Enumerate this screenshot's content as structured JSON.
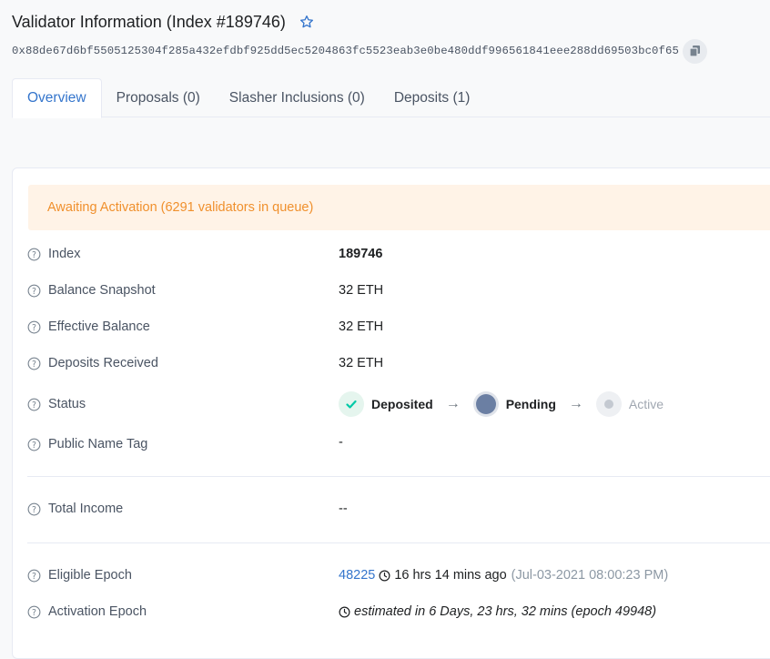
{
  "header": {
    "title": "Validator Information (Index #189746)",
    "pubkey": "0x88de67d6bf5505125304f285a432efdbf925dd5ec5204863fc5523eab3e0be480ddf996561841eee288dd69503bc0f65"
  },
  "tabs": [
    {
      "label": "Overview"
    },
    {
      "label": "Proposals (0)"
    },
    {
      "label": "Slasher Inclusions (0)"
    },
    {
      "label": "Deposits (1)"
    }
  ],
  "alert": "Awaiting Activation (6291 validators in queue)",
  "fields": {
    "index": {
      "label": "Index",
      "value": "189746"
    },
    "balance_snapshot": {
      "label": "Balance Snapshot",
      "value": "32 ETH"
    },
    "effective_balance": {
      "label": "Effective Balance",
      "value": "32 ETH"
    },
    "deposits_received": {
      "label": "Deposits Received",
      "value": "32 ETH"
    },
    "status": {
      "label": "Status",
      "steps": [
        {
          "label": "Deposited",
          "state": "done"
        },
        {
          "label": "Pending",
          "state": "current"
        },
        {
          "label": "Active",
          "state": "upcoming"
        }
      ]
    },
    "public_name_tag": {
      "label": "Public Name Tag",
      "value": "-"
    },
    "total_income": {
      "label": "Total Income",
      "value": "--"
    },
    "eligible_epoch": {
      "label": "Eligible Epoch",
      "epoch": "48225",
      "age": "16 hrs 14 mins ago",
      "timestamp": "(Jul-03-2021 08:00:23 PM)"
    },
    "activation_epoch": {
      "label": "Activation Epoch",
      "estimate": "estimated in 6 Days, 23 hrs, 32 mins (epoch 49948)"
    }
  },
  "colors": {
    "accent": "#3475cc",
    "alert_bg": "#fff3e7",
    "alert_text": "#f0902d",
    "success": "#00c9a7",
    "pending": "#6b7fa3"
  }
}
